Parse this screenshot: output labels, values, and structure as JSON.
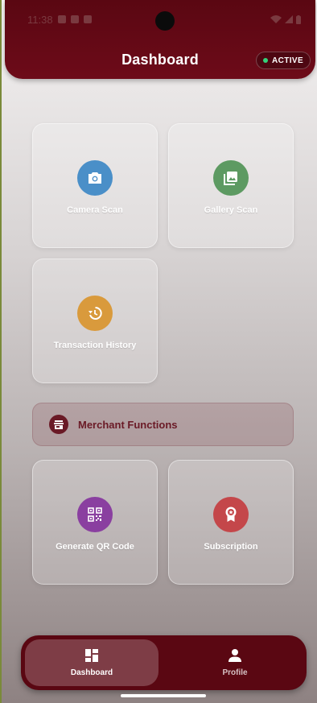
{
  "status_bar": {
    "time": "11:38"
  },
  "app_bar": {
    "title": "Dashboard",
    "badge": "ACTIVE"
  },
  "cards": [
    {
      "label": "Camera Scan",
      "icon": "camera-icon",
      "color": "#4a8fc8"
    },
    {
      "label": "Gallery Scan",
      "icon": "photo-library-icon",
      "color": "#5d9a62"
    },
    {
      "label": "Transaction History",
      "icon": "history-icon",
      "color": "#d99a3c"
    }
  ],
  "merchant_section": {
    "label": "Merchant Functions",
    "icon": "store-icon"
  },
  "merchant_cards": [
    {
      "label": "Generate QR Code",
      "icon": "qr-code-icon",
      "color": "#8a3fa0"
    },
    {
      "label": "Subscription",
      "icon": "badge-icon",
      "color": "#c4474a"
    }
  ],
  "bottom_nav": {
    "items": [
      {
        "label": "Dashboard",
        "icon": "dashboard-icon",
        "active": true
      },
      {
        "label": "Profile",
        "icon": "person-icon",
        "active": false
      }
    ]
  },
  "colors": {
    "primary": "#5a0712",
    "active_dot": "#34d27a"
  }
}
